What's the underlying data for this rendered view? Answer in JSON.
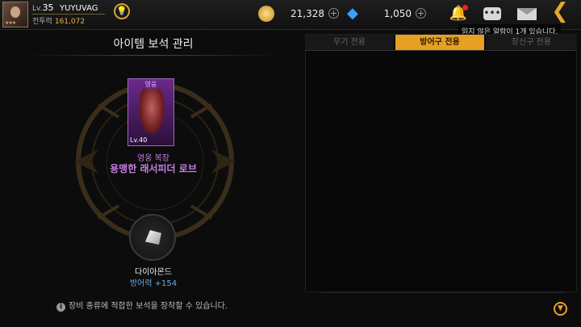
{
  "player": {
    "level_prefix": "Lv.",
    "level": "35",
    "name": "YUYUVAG",
    "power_label": "전투력",
    "power_value": "161,072",
    "stars": "★★★"
  },
  "currency": {
    "gold": "21,328",
    "gems": "1,050"
  },
  "notification_tooltip": "읽지 않은 알람이 1개 있습니다.",
  "left_panel": {
    "title": "아이템 보석 관리",
    "equipment": {
      "grade": "영웅",
      "level": "Lv.40",
      "type": "영웅 복장",
      "name": "용맹한 래서피더 로브"
    },
    "gem": {
      "name": "다이아몬드",
      "stat_label": "방어력",
      "stat_value": "+154"
    },
    "info_text": "장비 종류에 적합한 보석을 장착할 수 있습니다."
  },
  "tabs": [
    {
      "label": "무기 전용",
      "active": false
    },
    {
      "label": "방어구 전용",
      "active": true
    },
    {
      "label": "장신구 전용",
      "active": false
    }
  ],
  "colors": {
    "accent": "#e6a023",
    "hero_purple": "#c77fe6",
    "stat_blue": "#6aa8e8"
  }
}
